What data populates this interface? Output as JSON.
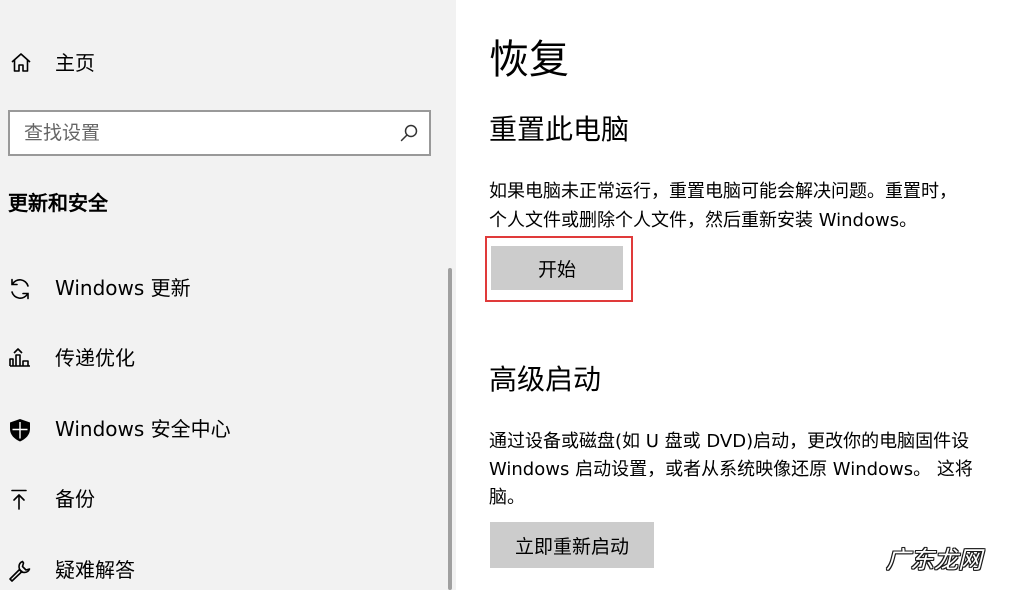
{
  "sidebar": {
    "home_label": "主页",
    "search": {
      "placeholder": "查找设置",
      "value": ""
    },
    "section_title": "更新和安全",
    "items": [
      {
        "label": "Windows 更新",
        "icon": "sync-icon"
      },
      {
        "label": "传递优化",
        "icon": "delivery-optimization-icon"
      },
      {
        "label": "Windows 安全中心",
        "icon": "shield-icon"
      },
      {
        "label": "备份",
        "icon": "backup-arrow-icon"
      },
      {
        "label": "疑难解答",
        "icon": "wrench-icon"
      }
    ]
  },
  "main": {
    "title": "恢复",
    "reset": {
      "heading": "重置此电脑",
      "desc_line1": "如果电脑未正常运行，重置电脑可能会解决问题。重置时，",
      "desc_line2": "个人文件或删除个人文件，然后重新安装 Windows。",
      "button": "开始"
    },
    "advanced": {
      "heading": "高级启动",
      "desc_line1": "通过设备或磁盘(如 U 盘或 DVD)启动，更改你的电脑固件设",
      "desc_line2": "Windows 启动设置，或者从系统映像还原 Windows。  这将",
      "desc_line3": "脑。",
      "button": "立即重新启动"
    }
  },
  "colors": {
    "sidebar_bg": "#f2f2f2",
    "button_bg": "#cccccc",
    "highlight": "#e03a3a"
  },
  "watermark": "广东龙网"
}
